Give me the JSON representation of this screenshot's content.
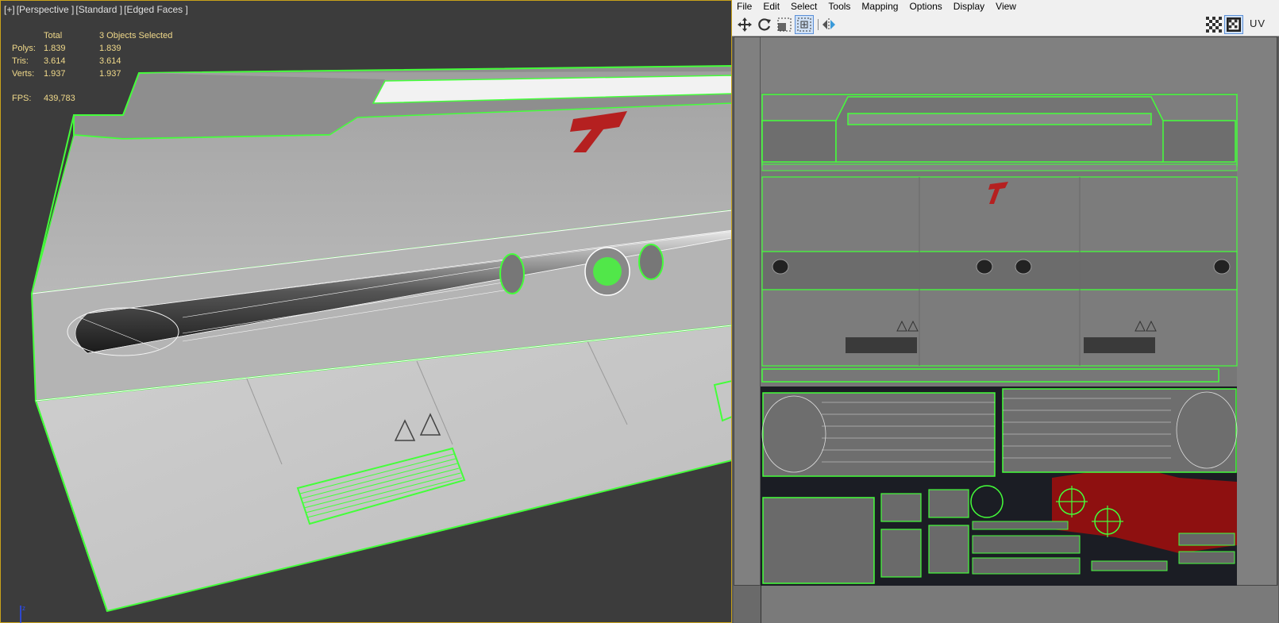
{
  "viewport": {
    "labels": [
      "[+]",
      "[Perspective ]",
      "[Standard ]",
      "[Edged Faces ]"
    ],
    "stats": {
      "header_total": "Total",
      "header_selected": "3 Objects Selected",
      "rows": [
        {
          "label": "Polys:",
          "total": "1.839",
          "selected": "1.839"
        },
        {
          "label": "Tris:",
          "total": "3.614",
          "selected": "3.614"
        },
        {
          "label": "Verts:",
          "total": "1.937",
          "selected": "1.937"
        }
      ],
      "fps_label": "FPS:",
      "fps_value": "439,783"
    },
    "accent_color": "#c9a21a",
    "selection_color": "#44ff3a",
    "stats_color": "#f0d98a"
  },
  "uv_editor": {
    "menu": [
      "File",
      "Edit",
      "Select",
      "Tools",
      "Mapping",
      "Options",
      "Display",
      "View"
    ],
    "toolbar_icons": [
      "move-icon",
      "rotate-icon",
      "scale-icon",
      "freeform-icon",
      "mirror-icon"
    ],
    "right_icons": [
      "checker-icon",
      "checker-alt-icon"
    ],
    "uv_label": "UV"
  }
}
